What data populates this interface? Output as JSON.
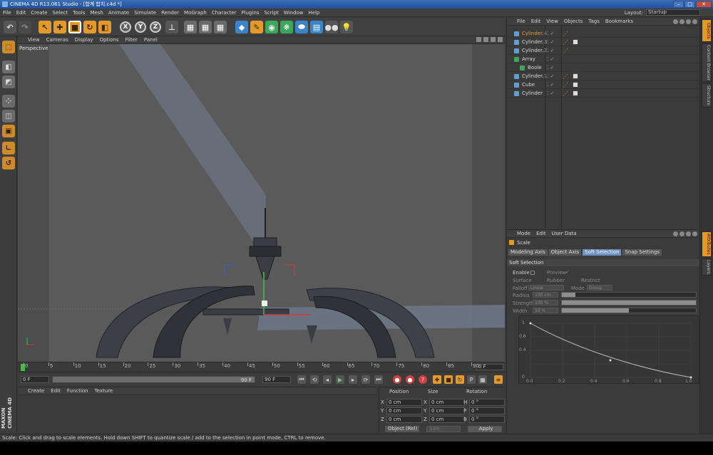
{
  "window": {
    "title": "CINEMA 4D R13.061 Studio - [합계 합치.c4d *]"
  },
  "menubar": [
    "File",
    "Edit",
    "Create",
    "Select",
    "Tools",
    "Mesh",
    "Animate",
    "Simulate",
    "Render",
    "MoGraph",
    "Character",
    "Plugins",
    "Script",
    "Window",
    "Help"
  ],
  "layout": {
    "label": "Layout:",
    "value": "Startup"
  },
  "viewport": {
    "menu": [
      "View",
      "Cameras",
      "Display",
      "Options",
      "Filter",
      "Panel"
    ],
    "label": "Perspective"
  },
  "timeline": {
    "ticks": [
      "0",
      "5",
      "10",
      "15",
      "20",
      "25",
      "30",
      "35",
      "40",
      "45",
      "50",
      "55",
      "60",
      "65",
      "70",
      "75",
      "80",
      "85",
      "90"
    ],
    "current_frame": "0 F"
  },
  "playback": {
    "start": "0 F",
    "slider_value": "90 F",
    "end": "90 F"
  },
  "material_manager": {
    "menu": [
      "Create",
      "Edit",
      "Function",
      "Texture"
    ]
  },
  "coordinates": {
    "headers": {
      "position": "Position",
      "size": "Size",
      "rotation": "Rotation"
    },
    "rows": [
      {
        "axis": "X",
        "pos": "0 cm",
        "saxis": "X",
        "size": "0 cm",
        "raxis": "H",
        "rot": "0 °"
      },
      {
        "axis": "Y",
        "pos": "0 cm",
        "saxis": "Y",
        "size": "0 cm",
        "raxis": "P",
        "rot": "0 °"
      },
      {
        "axis": "Z",
        "pos": "0 cm",
        "saxis": "Z",
        "size": "0 cm",
        "raxis": "B",
        "rot": "0 °"
      }
    ],
    "mode": "Object (Rel)",
    "size_mode": "Size",
    "apply": "Apply"
  },
  "status": "Scale: Click and drag to scale elements. Hold down SHIFT to quantize scale / add to the selection in point mode, CTRL to remove.",
  "maxon": "MAXON CINEMA 4D",
  "object_manager": {
    "menu": [
      "File",
      "Edit",
      "View",
      "Objects",
      "Tags",
      "Bookmarks"
    ],
    "objects": [
      {
        "name": "Cylinder.4",
        "indent": 0,
        "color": "#e49a2b",
        "highlight": true
      },
      {
        "name": "Cylinder.3",
        "indent": 0,
        "color": "#d6d6d6",
        "highlight": false
      },
      {
        "name": "Cylinder.2",
        "indent": 0,
        "color": "#d6d6d6",
        "highlight": false
      },
      {
        "name": "Array",
        "indent": 0,
        "color": "#d6d6d6",
        "highlight": false
      },
      {
        "name": "Boole",
        "indent": 1,
        "color": "#d6d6d6",
        "highlight": false
      },
      {
        "name": "Cylinder.1",
        "indent": 0,
        "color": "#d6d6d6",
        "highlight": false
      },
      {
        "name": "Cube",
        "indent": 0,
        "color": "#d6d6d6",
        "highlight": false
      },
      {
        "name": "Cylinder",
        "indent": 0,
        "color": "#d6d6d6",
        "highlight": false
      }
    ]
  },
  "side_tabs": {
    "top": [
      "Objects",
      "Content Browser",
      "Structure"
    ],
    "bottom": [
      "Attributes",
      "Layers"
    ]
  },
  "attributes": {
    "menu": [
      "Mode",
      "Edit",
      "User Data"
    ],
    "title": "Scale",
    "tabs": [
      "Modeling Axis",
      "Object Axis",
      "Soft Selection",
      "Snap Settings"
    ],
    "active_tab": "Soft Selection",
    "section": "Soft Selection",
    "enable": "Enable",
    "preview": "Preview",
    "surface": "Surface",
    "rubber": "Rubber",
    "restrict": "Restrict",
    "falloff_label": "Falloff",
    "falloff_value": "Linear",
    "mode_label": "Mode",
    "mode_value": "Group",
    "radius_label": "Radius",
    "radius_value": "100 cm",
    "radius_fraction": 0.1,
    "strength_label": "Strength",
    "strength_value": "100 %",
    "strength_fraction": 1.0,
    "width_label": "Width",
    "width_value": "50 %",
    "width_fraction": 0.5,
    "graph_y": [
      "1",
      "0.8",
      "0.4",
      "0"
    ],
    "graph_x": [
      "0.0",
      "0.2",
      "0.4",
      "0.6",
      "0.8",
      "1.0"
    ]
  }
}
